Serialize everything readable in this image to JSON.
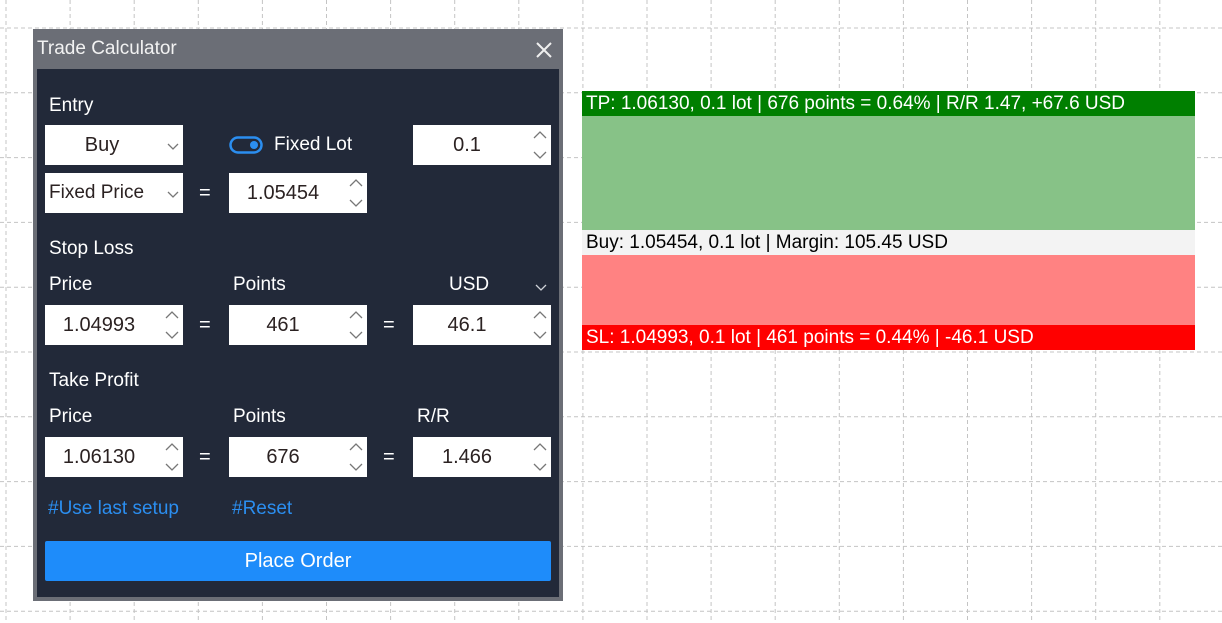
{
  "window": {
    "title": "Trade Calculator",
    "close_icon": "close-icon"
  },
  "entry": {
    "section_label": "Entry",
    "direction": "Buy",
    "toggle_label": "Fixed Lot",
    "toggle_on": true,
    "lot": "0.1",
    "price_mode": "Fixed Price",
    "equals": "=",
    "price": "1.05454"
  },
  "stop_loss": {
    "section_label": "Stop Loss",
    "price_label": "Price",
    "points_label": "Points",
    "currency_label": "USD",
    "price": "1.04993",
    "points": "461",
    "amount": "46.1"
  },
  "take_profit": {
    "section_label": "Take Profit",
    "price_label": "Price",
    "points_label": "Points",
    "rr_label": "R/R",
    "price": "1.06130",
    "points": "676",
    "rr": "1.466"
  },
  "links": {
    "use_last_setup": "#Use last setup",
    "reset": "#Reset"
  },
  "place_order_label": "Place Order",
  "chart_overlay": {
    "tp_text": "TP: 1.06130, 0.1 lot | 676 points = 0.64% | R/R 1.47, +67.6 USD",
    "entry_text": "Buy: 1.05454, 0.1 lot | Margin: 105.45 USD",
    "sl_text": "SL: 1.04993, 0.1 lot | 461 points = 0.44% | -46.1 USD",
    "colors": {
      "tp_bar": "#007f00",
      "tp_zone": "#87c287",
      "entry_bar": "#f3f3f3",
      "sl_zone": "#ff8282",
      "sl_bar": "#ff0000"
    }
  },
  "colors": {
    "panel_bg": "#222939",
    "title_bg": "#6b6e76",
    "accent": "#1e8cfa",
    "link": "#2b8ef0"
  }
}
